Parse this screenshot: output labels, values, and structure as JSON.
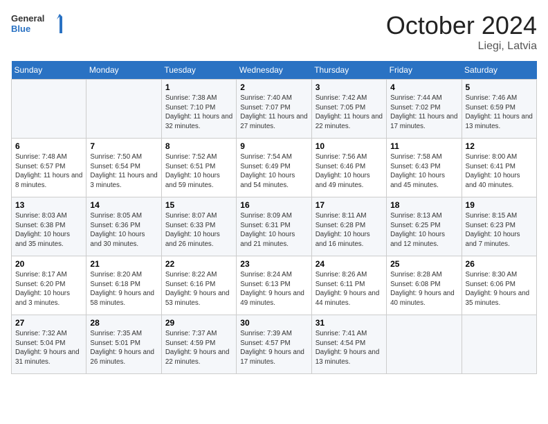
{
  "header": {
    "logo_line1": "General",
    "logo_line2": "Blue",
    "month": "October 2024",
    "location": "Liegi, Latvia"
  },
  "weekdays": [
    "Sunday",
    "Monday",
    "Tuesday",
    "Wednesday",
    "Thursday",
    "Friday",
    "Saturday"
  ],
  "weeks": [
    [
      {
        "day": "",
        "info": ""
      },
      {
        "day": "",
        "info": ""
      },
      {
        "day": "1",
        "info": "Sunrise: 7:38 AM\nSunset: 7:10 PM\nDaylight: 11 hours and 32 minutes."
      },
      {
        "day": "2",
        "info": "Sunrise: 7:40 AM\nSunset: 7:07 PM\nDaylight: 11 hours and 27 minutes."
      },
      {
        "day": "3",
        "info": "Sunrise: 7:42 AM\nSunset: 7:05 PM\nDaylight: 11 hours and 22 minutes."
      },
      {
        "day": "4",
        "info": "Sunrise: 7:44 AM\nSunset: 7:02 PM\nDaylight: 11 hours and 17 minutes."
      },
      {
        "day": "5",
        "info": "Sunrise: 7:46 AM\nSunset: 6:59 PM\nDaylight: 11 hours and 13 minutes."
      }
    ],
    [
      {
        "day": "6",
        "info": "Sunrise: 7:48 AM\nSunset: 6:57 PM\nDaylight: 11 hours and 8 minutes."
      },
      {
        "day": "7",
        "info": "Sunrise: 7:50 AM\nSunset: 6:54 PM\nDaylight: 11 hours and 3 minutes."
      },
      {
        "day": "8",
        "info": "Sunrise: 7:52 AM\nSunset: 6:51 PM\nDaylight: 10 hours and 59 minutes."
      },
      {
        "day": "9",
        "info": "Sunrise: 7:54 AM\nSunset: 6:49 PM\nDaylight: 10 hours and 54 minutes."
      },
      {
        "day": "10",
        "info": "Sunrise: 7:56 AM\nSunset: 6:46 PM\nDaylight: 10 hours and 49 minutes."
      },
      {
        "day": "11",
        "info": "Sunrise: 7:58 AM\nSunset: 6:43 PM\nDaylight: 10 hours and 45 minutes."
      },
      {
        "day": "12",
        "info": "Sunrise: 8:00 AM\nSunset: 6:41 PM\nDaylight: 10 hours and 40 minutes."
      }
    ],
    [
      {
        "day": "13",
        "info": "Sunrise: 8:03 AM\nSunset: 6:38 PM\nDaylight: 10 hours and 35 minutes."
      },
      {
        "day": "14",
        "info": "Sunrise: 8:05 AM\nSunset: 6:36 PM\nDaylight: 10 hours and 30 minutes."
      },
      {
        "day": "15",
        "info": "Sunrise: 8:07 AM\nSunset: 6:33 PM\nDaylight: 10 hours and 26 minutes."
      },
      {
        "day": "16",
        "info": "Sunrise: 8:09 AM\nSunset: 6:31 PM\nDaylight: 10 hours and 21 minutes."
      },
      {
        "day": "17",
        "info": "Sunrise: 8:11 AM\nSunset: 6:28 PM\nDaylight: 10 hours and 16 minutes."
      },
      {
        "day": "18",
        "info": "Sunrise: 8:13 AM\nSunset: 6:25 PM\nDaylight: 10 hours and 12 minutes."
      },
      {
        "day": "19",
        "info": "Sunrise: 8:15 AM\nSunset: 6:23 PM\nDaylight: 10 hours and 7 minutes."
      }
    ],
    [
      {
        "day": "20",
        "info": "Sunrise: 8:17 AM\nSunset: 6:20 PM\nDaylight: 10 hours and 3 minutes."
      },
      {
        "day": "21",
        "info": "Sunrise: 8:20 AM\nSunset: 6:18 PM\nDaylight: 9 hours and 58 minutes."
      },
      {
        "day": "22",
        "info": "Sunrise: 8:22 AM\nSunset: 6:16 PM\nDaylight: 9 hours and 53 minutes."
      },
      {
        "day": "23",
        "info": "Sunrise: 8:24 AM\nSunset: 6:13 PM\nDaylight: 9 hours and 49 minutes."
      },
      {
        "day": "24",
        "info": "Sunrise: 8:26 AM\nSunset: 6:11 PM\nDaylight: 9 hours and 44 minutes."
      },
      {
        "day": "25",
        "info": "Sunrise: 8:28 AM\nSunset: 6:08 PM\nDaylight: 9 hours and 40 minutes."
      },
      {
        "day": "26",
        "info": "Sunrise: 8:30 AM\nSunset: 6:06 PM\nDaylight: 9 hours and 35 minutes."
      }
    ],
    [
      {
        "day": "27",
        "info": "Sunrise: 7:32 AM\nSunset: 5:04 PM\nDaylight: 9 hours and 31 minutes."
      },
      {
        "day": "28",
        "info": "Sunrise: 7:35 AM\nSunset: 5:01 PM\nDaylight: 9 hours and 26 minutes."
      },
      {
        "day": "29",
        "info": "Sunrise: 7:37 AM\nSunset: 4:59 PM\nDaylight: 9 hours and 22 minutes."
      },
      {
        "day": "30",
        "info": "Sunrise: 7:39 AM\nSunset: 4:57 PM\nDaylight: 9 hours and 17 minutes."
      },
      {
        "day": "31",
        "info": "Sunrise: 7:41 AM\nSunset: 4:54 PM\nDaylight: 9 hours and 13 minutes."
      },
      {
        "day": "",
        "info": ""
      },
      {
        "day": "",
        "info": ""
      }
    ]
  ]
}
